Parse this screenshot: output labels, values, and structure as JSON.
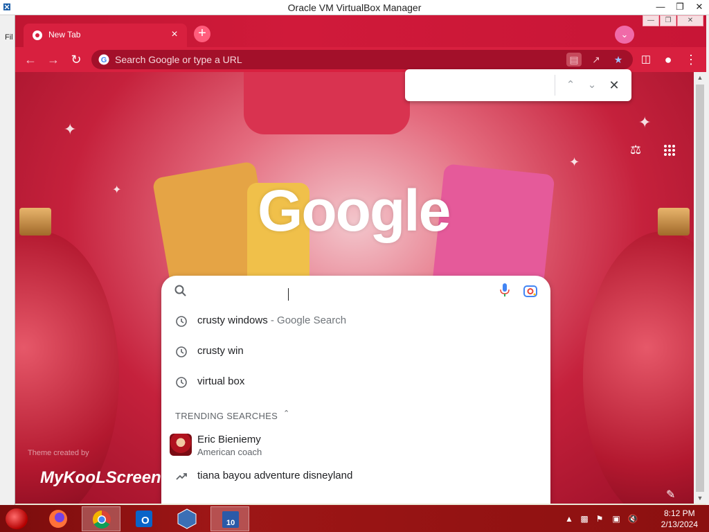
{
  "host": {
    "title": "Oracle VM VirtualBox Manager",
    "menu_file": "Fil"
  },
  "chrome": {
    "tab_title": "New Tab",
    "omnibox_placeholder": "Search Google or type a URL"
  },
  "ntp": {
    "logo_text": "Google",
    "credit_text": "Theme created by",
    "brand_text": "MyKooLScreen"
  },
  "findbar": {
    "value": ""
  },
  "realbox": {
    "value": "",
    "history": [
      {
        "text": "crusty windows",
        "suffix": " - Google Search"
      },
      {
        "text": "crusty win",
        "suffix": ""
      },
      {
        "text": "virtual box",
        "suffix": ""
      }
    ],
    "trending_heading": "TRENDING SEARCHES",
    "trending_person": {
      "name": "Eric Bieniemy",
      "description": "American coach"
    },
    "trending_query": "tiana bayou adventure disneyland"
  },
  "taskbar": {
    "time": "8:12 PM",
    "date": "2/13/2024"
  },
  "colors": {
    "accent": "#d8203f",
    "omnibox_bg": "#a3102a",
    "taskbar": "#8b1010"
  }
}
